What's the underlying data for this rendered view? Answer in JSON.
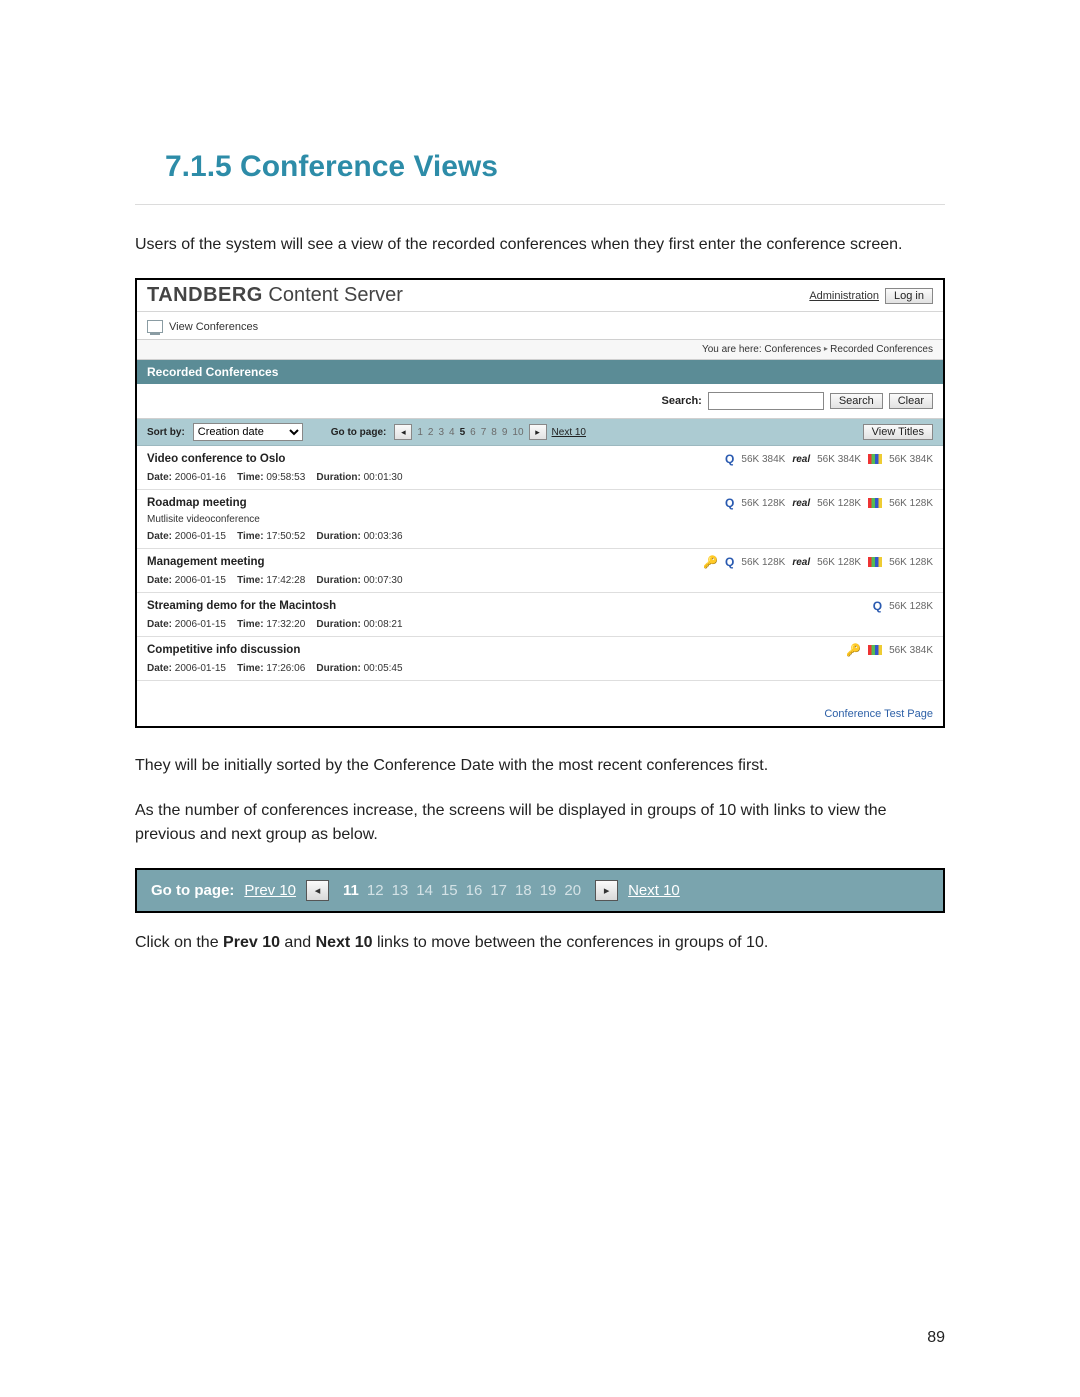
{
  "heading": "7.1.5  Conference Views",
  "intro": "Users of the system will see a view of the recorded conferences when they first enter the conference screen.",
  "after_shot1": "They will be initially sorted by the Conference Date with the most recent conferences first.",
  "after_shot2": "As the number of conferences increase, the screens will be displayed in groups of 10 with links to view the previous and next group as below.",
  "click_text_prefix": "Click on the ",
  "click_text_b1": "Prev 10",
  "click_text_mid": " and ",
  "click_text_b2": "Next 10",
  "click_text_suffix": " links to move between the conferences in groups of 10.",
  "page_number": "89",
  "screenshot": {
    "brand_bold": "TANDBERG",
    "brand_light": " Content Server",
    "admin_label": "Administration",
    "login_label": "Log in",
    "tab_view": "View Conferences",
    "breadcrumb_prefix": "You are here:  ",
    "breadcrumb_mid": "Conferences",
    "breadcrumb_end": "Recorded Conferences",
    "section_title": "Recorded Conferences",
    "search_label": "Search:",
    "search_btn": "Search",
    "clear_btn": "Clear",
    "sort_label": "Sort by:",
    "sort_value": "Creation date",
    "gotopage_label": "Go to page:",
    "view_titles_btn": "View Titles",
    "next10_label": "Next 10",
    "pages": [
      "1",
      "2",
      "3",
      "4",
      "5",
      "6",
      "7",
      "8",
      "9",
      "10"
    ],
    "current_page": "5",
    "footer_link": "Conference Test Page",
    "conferences": [
      {
        "title": "Video conference to Oslo",
        "subtitle": "",
        "date": "2006-01-16",
        "time": "09:58:53",
        "duration": "00:01:30",
        "has_key": false,
        "formats": [
          {
            "icon": "quicktime",
            "rates": "56K  384K"
          },
          {
            "icon": "real",
            "rates": "56K  384K"
          },
          {
            "icon": "winflag",
            "rates": "56K  384K"
          }
        ]
      },
      {
        "title": "Roadmap meeting",
        "subtitle": "Mutlisite videoconference",
        "date": "2006-01-15",
        "time": "17:50:52",
        "duration": "00:03:36",
        "has_key": false,
        "formats": [
          {
            "icon": "quicktime",
            "rates": "56K  128K"
          },
          {
            "icon": "real",
            "rates": "56K  128K"
          },
          {
            "icon": "winflag",
            "rates": "56K  128K"
          }
        ]
      },
      {
        "title": "Management meeting",
        "subtitle": "",
        "date": "2006-01-15",
        "time": "17:42:28",
        "duration": "00:07:30",
        "has_key": true,
        "formats": [
          {
            "icon": "quicktime",
            "rates": "56K 128K"
          },
          {
            "icon": "real",
            "rates": "56K 128K"
          },
          {
            "icon": "winflag",
            "rates": "56K 128K"
          }
        ]
      },
      {
        "title": "Streaming demo for the Macintosh",
        "subtitle": "",
        "date": "2006-01-15",
        "time": "17:32:20",
        "duration": "00:08:21",
        "has_key": false,
        "formats": [
          {
            "icon": "quicktime",
            "rates": "56K  128K"
          }
        ]
      },
      {
        "title": "Competitive info discussion",
        "subtitle": "",
        "date": "2006-01-15",
        "time": "17:26:06",
        "duration": "00:05:45",
        "has_key": true,
        "formats": [
          {
            "icon": "winflag",
            "rates": "56K 384K"
          }
        ]
      }
    ],
    "meta_labels": {
      "date": "Date:",
      "time": "Time:",
      "duration": "Duration:"
    }
  },
  "pager2": {
    "label": "Go to page:",
    "prev": "Prev 10",
    "next": "Next 10",
    "pages": [
      "11",
      "12",
      "13",
      "14",
      "15",
      "16",
      "17",
      "18",
      "19",
      "20"
    ],
    "current": "11"
  }
}
